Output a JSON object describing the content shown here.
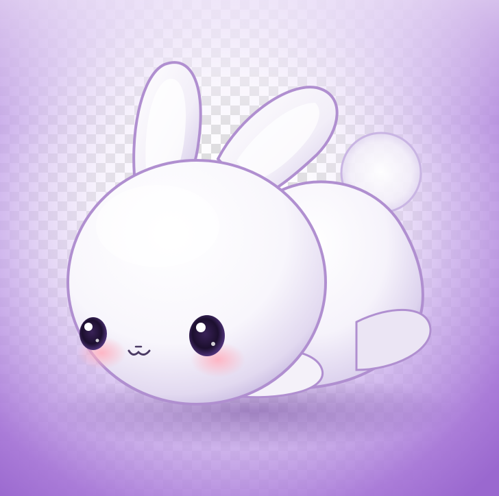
{
  "image": {
    "subject": "bunny",
    "background": "transparency-checkerboard"
  },
  "colors": {
    "checker_light": "#ffffff",
    "checker_dark": "#d6d6d6",
    "backdrop_center": "#ffffff",
    "backdrop_edge": "#9a68cf",
    "fur": "#ffffff",
    "fur_shade": "#c9bfe0",
    "outline": "#b08fd0",
    "eye": "#1c0f2e",
    "eye_glint": "#ffffff",
    "cheek": "#ffb3c2",
    "mouth": "#4b3a64"
  }
}
